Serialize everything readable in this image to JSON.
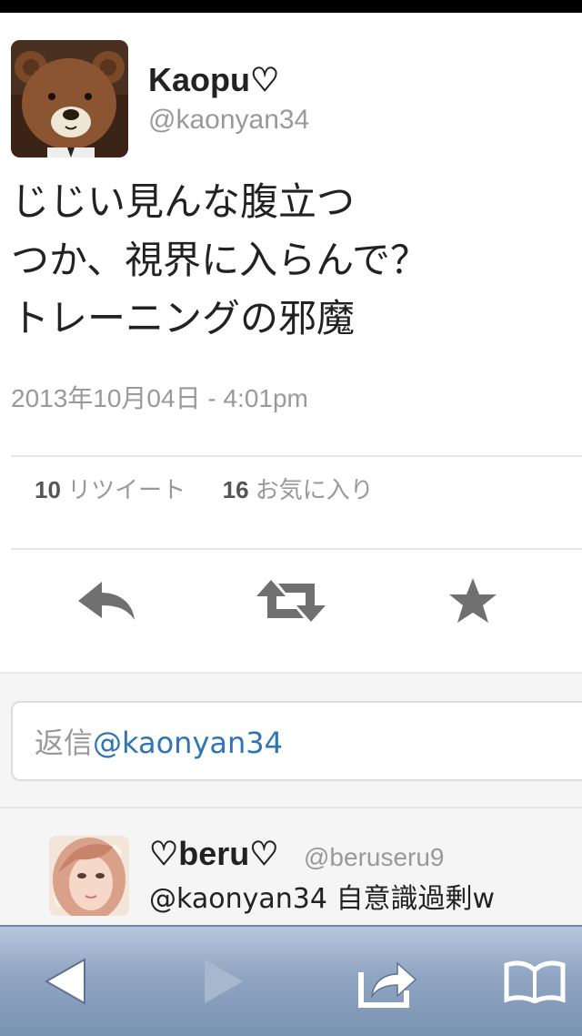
{
  "tweet": {
    "user": {
      "name": "Kaopu♡",
      "handle": "@kaonyan34"
    },
    "text_lines": [
      "じじい見んな腹立つ",
      "つか、視界に入らんで？",
      "トレーニングの邪魔"
    ],
    "date": "2013年10月04日 - 4:01pm",
    "stats": {
      "retweet_count": "10",
      "retweet_label": "リツイート",
      "favorite_count": "16",
      "favorite_label": "お気に入り"
    },
    "actions": [
      {
        "name": "reply",
        "icon": "reply-icon"
      },
      {
        "name": "retweet",
        "icon": "retweet-icon"
      },
      {
        "name": "favorite",
        "icon": "star-icon"
      }
    ]
  },
  "reply_box": {
    "placeholder_prefix": "返信",
    "placeholder_mention": "@kaonyan34"
  },
  "replies": [
    {
      "name": "♡beru♡",
      "handle": "@beruseru9",
      "text": "@kaonyan34 自意識過剰w"
    }
  ],
  "browser_toolbar": {
    "buttons": [
      {
        "name": "back",
        "icon": "back-arrow-icon"
      },
      {
        "name": "forward",
        "icon": "forward-arrow-icon"
      },
      {
        "name": "share",
        "icon": "share-icon"
      },
      {
        "name": "bookmarks",
        "icon": "book-icon"
      }
    ]
  },
  "colors": {
    "mention": "#2f75b5",
    "secondary_text": "#999999",
    "icon_gray": "#707070",
    "toolbar_blue": "#8fa5c2"
  }
}
